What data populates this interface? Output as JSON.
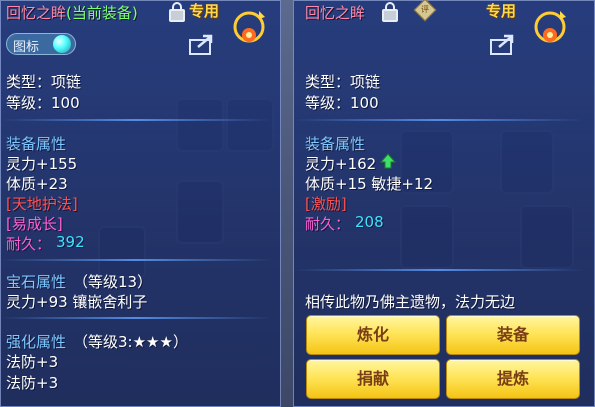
{
  "left": {
    "title": "回忆之眸",
    "equipped": "(当前装备)",
    "exclusive": "专用",
    "icon_tag": "图标",
    "type": "类型：项链",
    "level": "等级：100",
    "section_attr": "装备属性",
    "attrs": [
      "灵力+155",
      "体质+23"
    ],
    "special1": "[天地护法]",
    "special2": "[易成长]",
    "durability_label": "耐久：",
    "durability_value": "392",
    "gem_label": "宝石属性",
    "gem_level": "（等级13）",
    "gem_detail": "灵力+93 镶嵌舍利子",
    "enhance_label": "强化属性",
    "enhance_level": "（等级3:★★★）",
    "enhance_attrs": [
      "法防+3",
      "法防+3"
    ]
  },
  "right": {
    "title": "回忆之眸",
    "badge": "评",
    "exclusive": "专用",
    "type": "类型：项链",
    "level": "等级：100",
    "section_attr": "装备属性",
    "attr1": "灵力+162",
    "attr2": "体质+15 敏捷+12",
    "special": "[激励]",
    "durability_label": "耐久：",
    "durability_value": "208",
    "description": "相传此物乃佛主遗物，法力无边",
    "buttons": [
      "炼化",
      "装备",
      "捐献",
      "提炼"
    ]
  },
  "colors": {
    "title": "#ff8aa8",
    "equipped": "#7dff6e",
    "section": "#7ec8ff",
    "durability": "#3fe1ff",
    "special": "#ff5fd0",
    "button": "#ffe55a"
  }
}
